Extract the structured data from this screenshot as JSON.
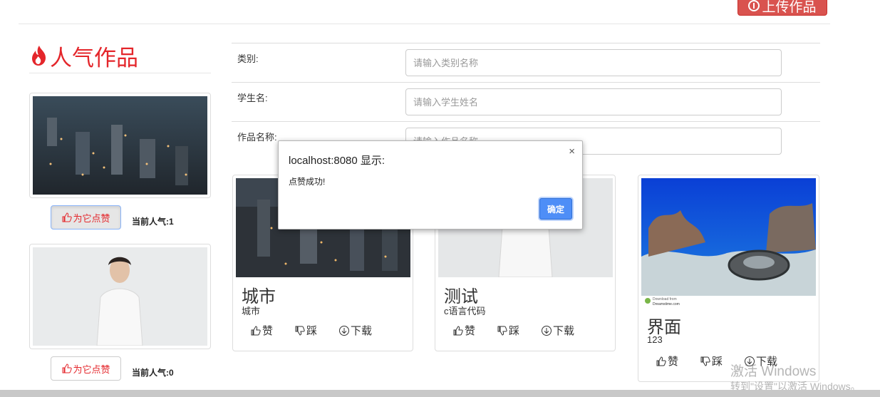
{
  "header": {
    "upload_label": "上传作品"
  },
  "popular": {
    "title": "人气作品",
    "items": [
      {
        "like_label": "为它点赞",
        "popularity_label": "当前人气:",
        "popularity_value": "1"
      },
      {
        "like_label": "为它点赞",
        "popularity_label": "当前人气:",
        "popularity_value": "0"
      }
    ]
  },
  "form": {
    "category_label": "类别:",
    "category_placeholder": "请输入类别名称",
    "student_label": "学生名:",
    "student_placeholder": "请输入学生姓名",
    "work_label": "作品名称:",
    "work_placeholder": "请输入作品名称"
  },
  "works": [
    {
      "title": "城市",
      "subtitle": "城市",
      "like": "赞",
      "dislike": "踩",
      "download": "下载"
    },
    {
      "title": "测试",
      "subtitle": "c语言代码",
      "like": "赞",
      "dislike": "踩",
      "download": "下载"
    },
    {
      "title": "界面",
      "subtitle": "123",
      "like": "赞",
      "dislike": "踩",
      "download": "下载",
      "image_text_1": "Download from",
      "image_text_2": "Dreamstime.com"
    }
  ],
  "dialog": {
    "title": "localhost:8080 显示:",
    "message": "点赞成功!",
    "close": "×",
    "ok": "确定"
  },
  "watermark": {
    "line1": "激活 Windows",
    "line2": "转到\"设置\"以激活 Windows。"
  },
  "colors": {
    "accent_red": "#e4262b",
    "upload_red": "#d9534f",
    "ok_blue": "#4e8ef7"
  }
}
